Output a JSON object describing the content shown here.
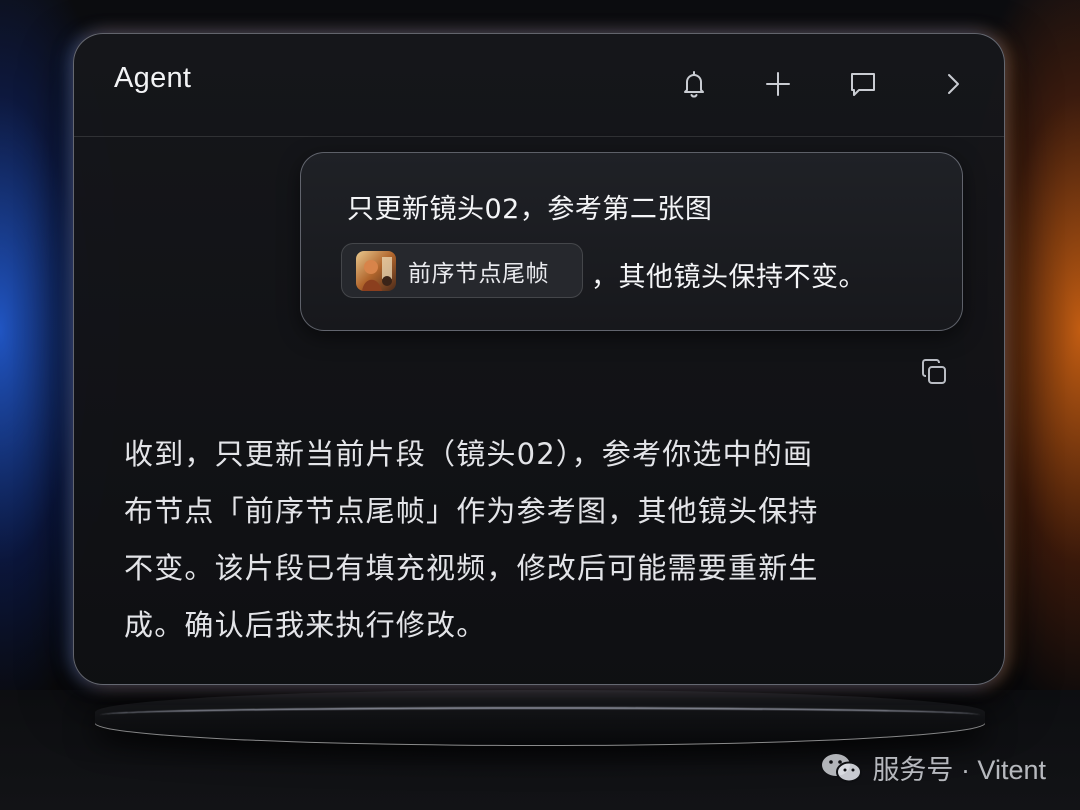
{
  "panel": {
    "title": "Agent",
    "header_icons": [
      "bell-icon",
      "plus-icon",
      "chat-icon",
      "chevron-right-icon"
    ]
  },
  "user_message": {
    "line1": "只更新镜头02，参考第二张图",
    "chip_label": "前序节点尾帧",
    "line2": "，其他镜头保持不变。"
  },
  "copy_icon": "copy-icon",
  "assistant_reply": {
    "lines": [
      "收到，只更新当前片段（镜头02），参考你选中的画",
      "布节点「前序节点尾帧」作为参考图，其他镜头保持",
      "不变。该片段已有填充视频，修改后可能需要重新生",
      "成。确认后我来执行修改。"
    ]
  },
  "watermark": "服务号 · Vitent",
  "colors": {
    "left_glow": "#2a6eff",
    "right_glow": "#ff8a1f",
    "panel_bg": "#16171b",
    "text": "#f2f3f5"
  }
}
